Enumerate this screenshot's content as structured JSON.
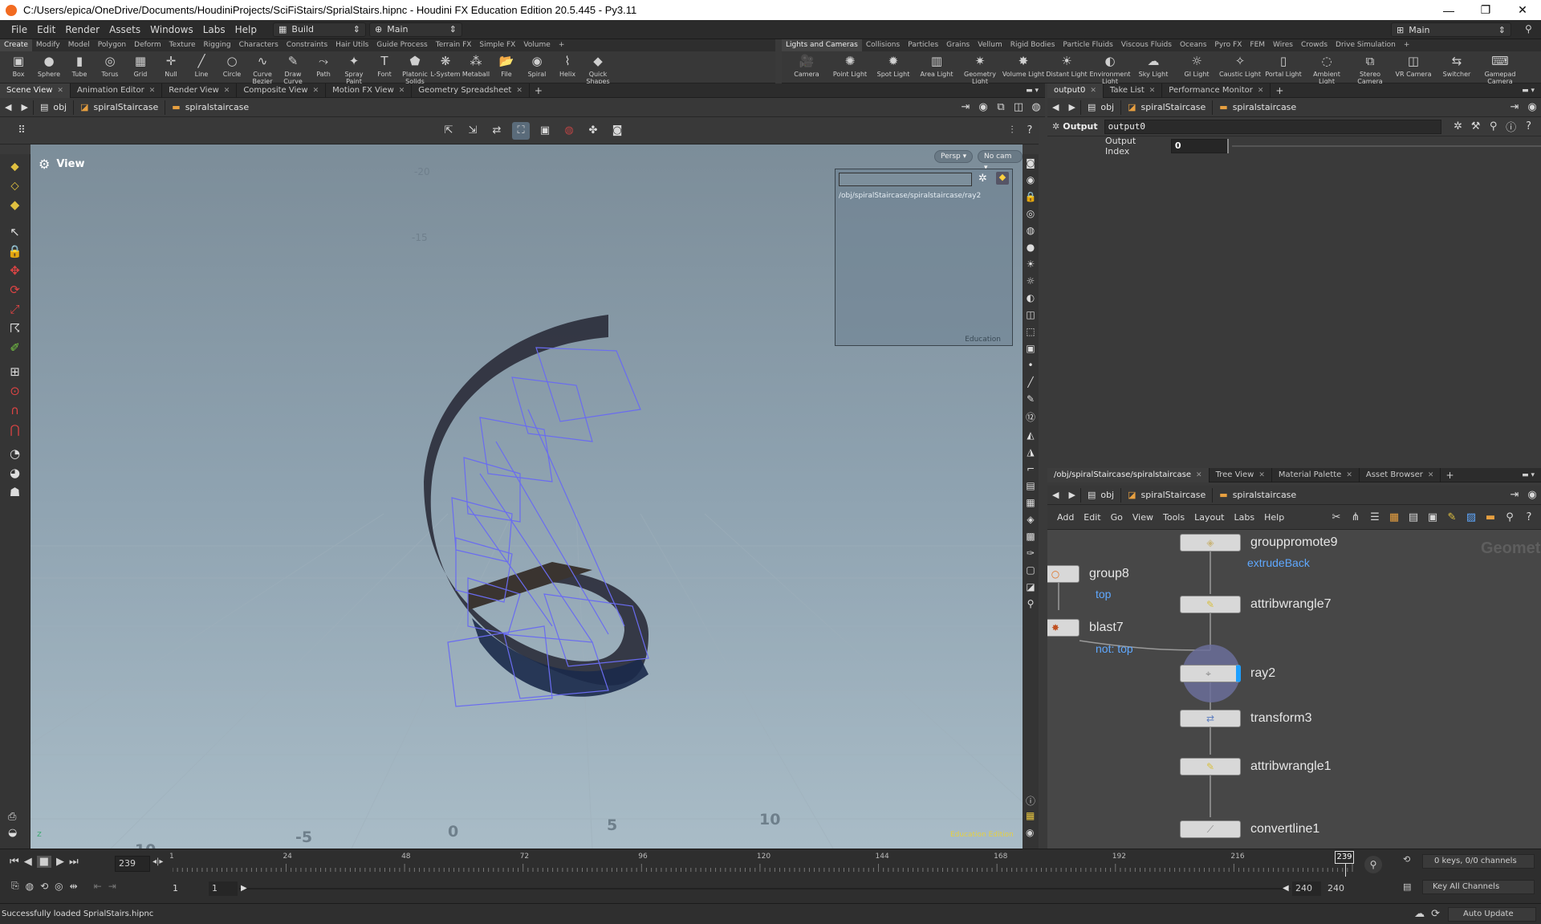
{
  "window": {
    "title": "C:/Users/epica/OneDrive/Documents/HoudiniProjects/SciFiStairs/SprialStairs.hipnc - Houdini FX Education Edition 20.5.445 - Py3.11",
    "min": "—",
    "max": "❐",
    "close": "✕"
  },
  "menu": {
    "items": [
      "File",
      "Edit",
      "Render",
      "Assets",
      "Windows",
      "Labs",
      "Help"
    ],
    "build": "Build",
    "desktop": "Main",
    "right_desktop": "Main"
  },
  "shelf_left": {
    "tabs": [
      "Create",
      "Modify",
      "Model",
      "Polygon",
      "Deform",
      "Texture",
      "Rigging",
      "Characters",
      "Constraints",
      "Hair Utils",
      "Guide Process",
      "Terrain FX",
      "Simple FX",
      "Volume"
    ],
    "tools": [
      {
        "label": "Box",
        "icon": "▣"
      },
      {
        "label": "Sphere",
        "icon": "●"
      },
      {
        "label": "Tube",
        "icon": "▮"
      },
      {
        "label": "Torus",
        "icon": "◎"
      },
      {
        "label": "Grid",
        "icon": "▦"
      },
      {
        "label": "Null",
        "icon": "✛"
      },
      {
        "label": "Line",
        "icon": "╱"
      },
      {
        "label": "Circle",
        "icon": "○"
      },
      {
        "label": "Curve Bezier",
        "icon": "∿"
      },
      {
        "label": "Draw Curve",
        "icon": "✎"
      },
      {
        "label": "Path",
        "icon": "⤳"
      },
      {
        "label": "Spray Paint",
        "icon": "✦"
      },
      {
        "label": "Font",
        "icon": "T"
      },
      {
        "label": "Platonic Solids",
        "icon": "⬟"
      },
      {
        "label": "L-System",
        "icon": "❋"
      },
      {
        "label": "Metaball",
        "icon": "⁂"
      },
      {
        "label": "File",
        "icon": "📂"
      },
      {
        "label": "Spiral",
        "icon": "◉"
      },
      {
        "label": "Helix",
        "icon": "⌇"
      },
      {
        "label": "Quick Shapes",
        "icon": "◆"
      }
    ]
  },
  "shelf_right": {
    "tabs": [
      "Lights and Cameras",
      "Collisions",
      "Particles",
      "Grains",
      "Vellum",
      "Rigid Bodies",
      "Particle Fluids",
      "Viscous Fluids",
      "Oceans",
      "Pyro FX",
      "FEM",
      "Wires",
      "Crowds",
      "Drive Simulation"
    ],
    "tools": [
      {
        "label": "Camera",
        "icon": "🎥"
      },
      {
        "label": "Point Light",
        "icon": "✺"
      },
      {
        "label": "Spot Light",
        "icon": "✹"
      },
      {
        "label": "Area Light",
        "icon": "▥"
      },
      {
        "label": "Geometry Light",
        "icon": "✷"
      },
      {
        "label": "Volume Light",
        "icon": "✸"
      },
      {
        "label": "Distant Light",
        "icon": "☀"
      },
      {
        "label": "Environment Light",
        "icon": "◐"
      },
      {
        "label": "Sky Light",
        "icon": "☁"
      },
      {
        "label": "GI Light",
        "icon": "☼"
      },
      {
        "label": "Caustic Light",
        "icon": "✧"
      },
      {
        "label": "Portal Light",
        "icon": "▯"
      },
      {
        "label": "Ambient Light",
        "icon": "◌"
      },
      {
        "label": "Stereo Camera",
        "icon": "⧉"
      },
      {
        "label": "VR Camera",
        "icon": "◫"
      },
      {
        "label": "Switcher",
        "icon": "⇆"
      },
      {
        "label": "Gamepad Camera",
        "icon": "⌨"
      }
    ]
  },
  "pane_tabs_left": [
    "Scene View",
    "Animation Editor",
    "Render View",
    "Composite View",
    "Motion FX View",
    "Geometry Spreadsheet"
  ],
  "pane_tabs_right_top": [
    "output0",
    "Take List",
    "Performance Monitor"
  ],
  "pane_tabs_right_bottom": [
    "/obj/spiralStaircase/spiralstaircase",
    "Tree View",
    "Material Palette",
    "Asset Browser"
  ],
  "path": {
    "root": "obj",
    "object": "spiralStaircase",
    "sop": "spiralstaircase"
  },
  "viewport": {
    "label": "View",
    "persp": "Persp ▾",
    "cam": "No cam ▾",
    "info_path": "/obj/spiralStaircase/spiralstaircase/ray2",
    "info_watermark": "Education",
    "watermark": "Education Edition",
    "axis": "z",
    "grid_labels": [
      {
        "text": "-10",
        "cls": "g1"
      },
      {
        "text": "-5",
        "cls": "g2"
      },
      {
        "text": "0",
        "cls": "g3"
      },
      {
        "text": "5",
        "cls": "g4"
      },
      {
        "text": "10",
        "cls": "g5"
      },
      {
        "text": "0",
        "cls": "g6"
      }
    ]
  },
  "params": {
    "type": "Output",
    "name": "output0",
    "field_label": "Output Index",
    "field_value": "0"
  },
  "network": {
    "menu": [
      "Add",
      "Edit",
      "Go",
      "View",
      "Tools",
      "Layout",
      "Labs",
      "Help"
    ],
    "context": "Geometry",
    "nodes": [
      {
        "name": "grouppromote9",
        "sub": "extrudeBack",
        "color": "#c9b57a",
        "icon": "◈"
      },
      {
        "name": "group8",
        "sub": "top",
        "color": "#e07020",
        "icon": "○"
      },
      {
        "name": "attribwrangle7",
        "sub": "",
        "color": "#d8c040",
        "icon": "✎"
      },
      {
        "name": "blast7",
        "sub": "not: top",
        "color": "#c05020",
        "icon": "✸"
      },
      {
        "name": "ray2",
        "sub": "",
        "color": "#888",
        "icon": "⌖"
      },
      {
        "name": "transform3",
        "sub": "",
        "color": "#6080c0",
        "icon": "⇄"
      },
      {
        "name": "attribwrangle1",
        "sub": "",
        "color": "#d8c040",
        "icon": "✎"
      },
      {
        "name": "convertline1",
        "sub": "",
        "color": "#888",
        "icon": "⟋"
      }
    ]
  },
  "timeline": {
    "current_frame": "239",
    "ticks": [
      "1",
      "24",
      "48",
      "72",
      "96",
      "120",
      "144",
      "168",
      "192",
      "216"
    ],
    "playhead": "239",
    "start": "1",
    "start2": "1",
    "end": "240",
    "end2": "240",
    "keys": "0 keys, 0/0 channels",
    "key_all": "Key All Channels",
    "auto_update": "Auto Update"
  },
  "status": {
    "message": "Successfully loaded SprialStairs.hipnc"
  }
}
